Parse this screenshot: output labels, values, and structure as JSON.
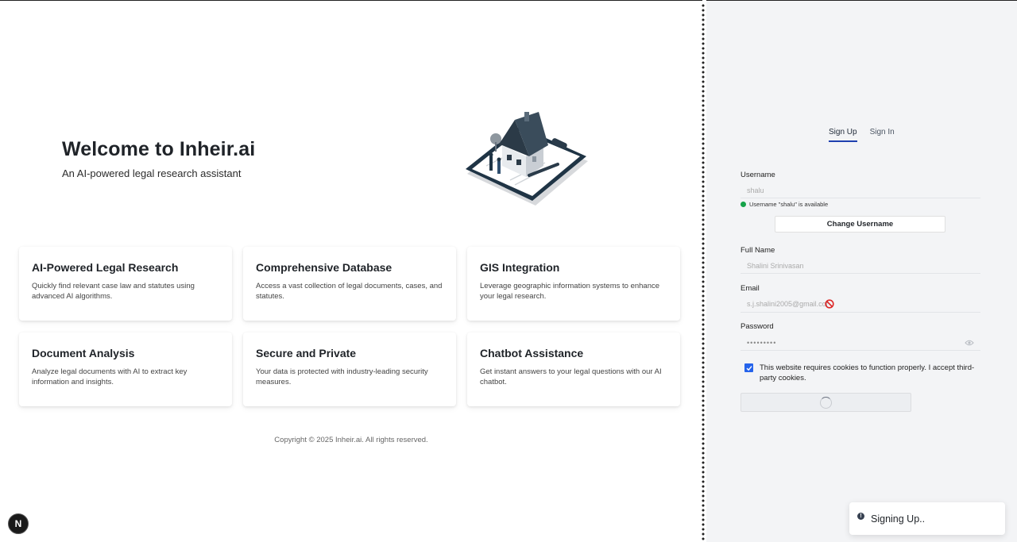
{
  "hero": {
    "title": "Welcome to Inheir.ai",
    "subtitle": "An AI-powered legal research assistant"
  },
  "features": [
    {
      "title": "AI-Powered Legal Research",
      "description": "Quickly find relevant case law and statutes using advanced AI algorithms."
    },
    {
      "title": "Comprehensive Database",
      "description": "Access a vast collection of legal documents, cases, and statutes."
    },
    {
      "title": "GIS Integration",
      "description": "Leverage geographic information systems to enhance your legal research."
    },
    {
      "title": "Document Analysis",
      "description": "Analyze legal documents with AI to extract key information and insights."
    },
    {
      "title": "Secure and Private",
      "description": "Your data is protected with industry-leading security measures."
    },
    {
      "title": "Chatbot Assistance",
      "description": "Get instant answers to your legal questions with our AI chatbot."
    }
  ],
  "footer": {
    "copyright": "Copyright © 2025 Inheir.ai. All rights reserved."
  },
  "badge": {
    "label": "N"
  },
  "auth": {
    "tabs": [
      {
        "label": "Sign Up",
        "active": true
      },
      {
        "label": "Sign In",
        "active": false
      }
    ],
    "username": {
      "label": "Username",
      "value": "shalu",
      "status": "Username \"shalu\" is available"
    },
    "change_username_label": "Change Username",
    "full_name": {
      "label": "Full Name",
      "value": "Shalini Srinivasan"
    },
    "email": {
      "label": "Email",
      "value": "s.j.shalini2005@gmail.com"
    },
    "password": {
      "label": "Password",
      "value": "password1"
    },
    "cookie_consent": {
      "checked": true,
      "text": "This website requires cookies to function properly. I accept third-party cookies."
    }
  },
  "toast": {
    "icon": "info-icon",
    "message": "Signing Up.."
  },
  "colors": {
    "accent": "#2563eb",
    "tab_underline": "#1e40af",
    "success": "#16a34a",
    "panel_bg": "#f3f4f6",
    "blocked": "#dc2626"
  }
}
